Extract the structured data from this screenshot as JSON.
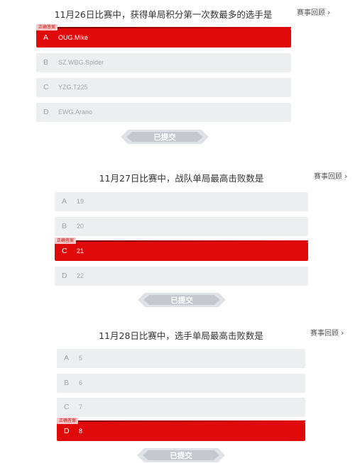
{
  "review_label": "赛事回顾",
  "correct_tag": "正确答案",
  "submitted_label": "已提交",
  "quizzes": [
    {
      "question": "11月26日比赛中，获得单局积分第一次数最多的选手是",
      "options": [
        {
          "letter": "A",
          "text": "OUG.Mike",
          "correct": true
        },
        {
          "letter": "B",
          "text": "SZ.WBG.Spider",
          "correct": false
        },
        {
          "letter": "C",
          "text": "YZG.T225",
          "correct": false
        },
        {
          "letter": "D",
          "text": "EWG.Arano",
          "correct": false
        }
      ]
    },
    {
      "question": "11月27日比赛中，战队单局最高击败数是",
      "options": [
        {
          "letter": "A",
          "text": "19",
          "correct": false
        },
        {
          "letter": "B",
          "text": "20",
          "correct": false
        },
        {
          "letter": "C",
          "text": "21",
          "correct": true
        },
        {
          "letter": "D",
          "text": "22",
          "correct": false
        }
      ]
    },
    {
      "question": "11月28日比赛中，选手单局最高击败数是",
      "options": [
        {
          "letter": "A",
          "text": "5",
          "correct": false
        },
        {
          "letter": "B",
          "text": "6",
          "correct": false
        },
        {
          "letter": "C",
          "text": "7",
          "correct": false
        },
        {
          "letter": "D",
          "text": "8",
          "correct": true
        }
      ]
    }
  ]
}
